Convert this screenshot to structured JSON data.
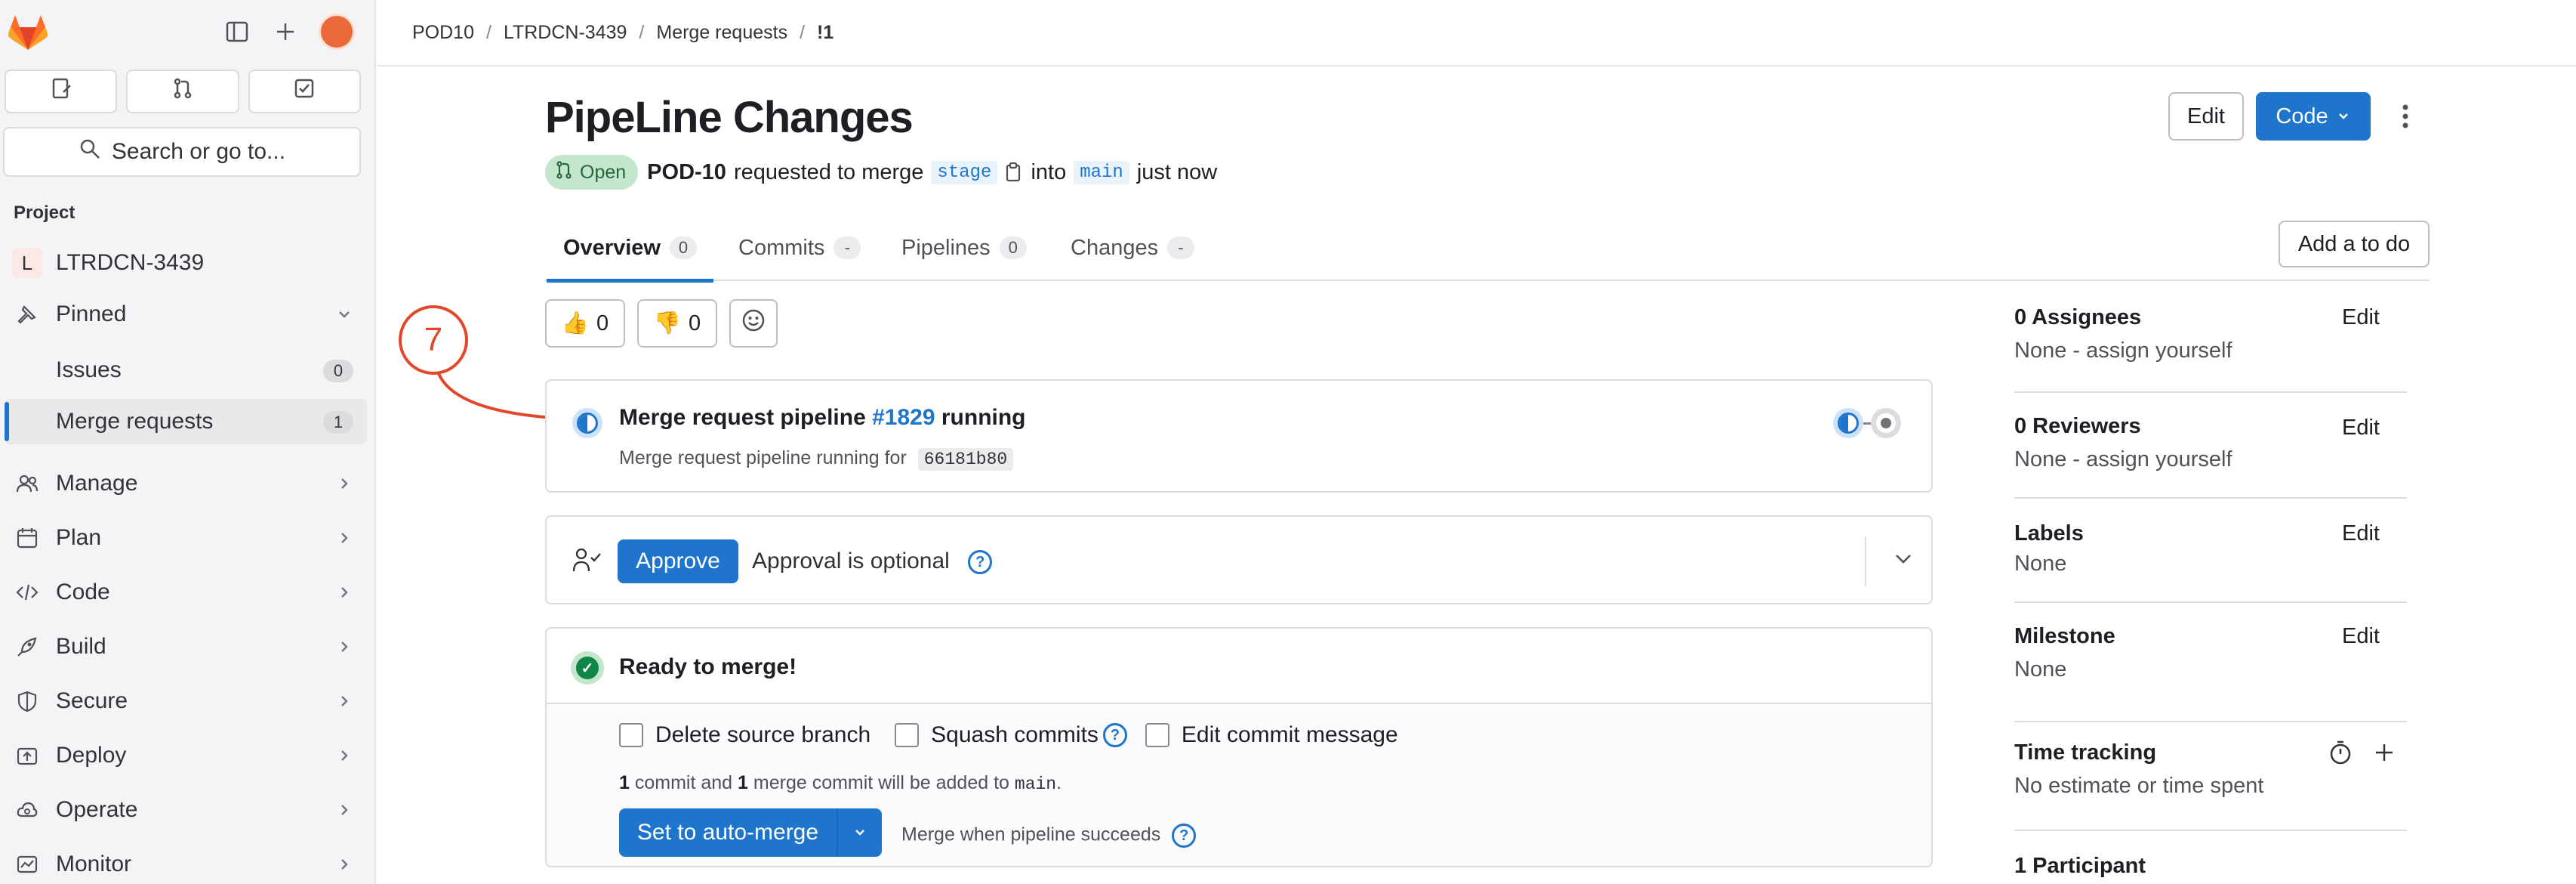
{
  "sidebar": {
    "search_label": "Search or go to...",
    "section_title": "Project",
    "project": {
      "letter": "L",
      "name": "LTRDCN-3439"
    },
    "pinned_label": "Pinned",
    "pinned_items": [
      {
        "label": "Issues",
        "count": "0"
      },
      {
        "label": "Merge requests",
        "count": "1"
      }
    ],
    "nav_items": [
      {
        "label": "Manage",
        "icon": "users-icon"
      },
      {
        "label": "Plan",
        "icon": "calendar-icon"
      },
      {
        "label": "Code",
        "icon": "code-icon"
      },
      {
        "label": "Build",
        "icon": "rocket-icon"
      },
      {
        "label": "Secure",
        "icon": "shield-icon"
      },
      {
        "label": "Deploy",
        "icon": "deploy-icon"
      },
      {
        "label": "Operate",
        "icon": "cloud-icon"
      },
      {
        "label": "Monitor",
        "icon": "monitor-icon"
      }
    ]
  },
  "breadcrumb": [
    "POD10",
    "LTRDCN-3439",
    "Merge requests",
    "!1"
  ],
  "header": {
    "title": "PipeLine Changes",
    "edit_label": "Edit",
    "code_label": "Code",
    "status": "Open",
    "author": "POD-10",
    "requested_text": "requested to merge",
    "source_branch": "stage",
    "into_text": "into",
    "target_branch": "main",
    "time": "just now"
  },
  "tabs": [
    {
      "label": "Overview",
      "count": "0"
    },
    {
      "label": "Commits",
      "count": "-"
    },
    {
      "label": "Pipelines",
      "count": "0"
    },
    {
      "label": "Changes",
      "count": "-"
    }
  ],
  "add_todo_label": "Add a to do",
  "reactions": {
    "thumbs_up": "0",
    "thumbs_down": "0"
  },
  "annotation_number": "7",
  "pipeline": {
    "title_prefix": "Merge request pipeline",
    "pipeline_id": "#1829",
    "status_word": "running",
    "subtitle": "Merge request pipeline running for",
    "sha": "66181b80"
  },
  "approval": {
    "button_label": "Approve",
    "text": "Approval is optional"
  },
  "merge": {
    "title": "Ready to merge!",
    "checkboxes": [
      "Delete source branch",
      "Squash commits",
      "Edit commit message"
    ],
    "commit_count": "1",
    "commit_text1": "commit and",
    "merge_count": "1",
    "commit_text2": "merge commit will be added to",
    "target": "main",
    "auto_merge_label": "Set to auto-merge",
    "merge_when_text": "Merge when pipeline succeeds"
  },
  "right_sidebar": {
    "assignees_title": "0 Assignees",
    "assignees_value": "None - assign yourself",
    "reviewers_title": "0 Reviewers",
    "reviewers_value": "None - assign yourself",
    "labels_title": "Labels",
    "labels_value": "None",
    "milestone_title": "Milestone",
    "milestone_value": "None",
    "time_title": "Time tracking",
    "time_value": "No estimate or time spent",
    "participants_title": "1 Participant",
    "edit_label": "Edit"
  },
  "colors": {
    "accent": "#1f75cb",
    "open_badge_bg": "#c3e6cd",
    "success": "#108548",
    "annotation": "#e3472b"
  }
}
